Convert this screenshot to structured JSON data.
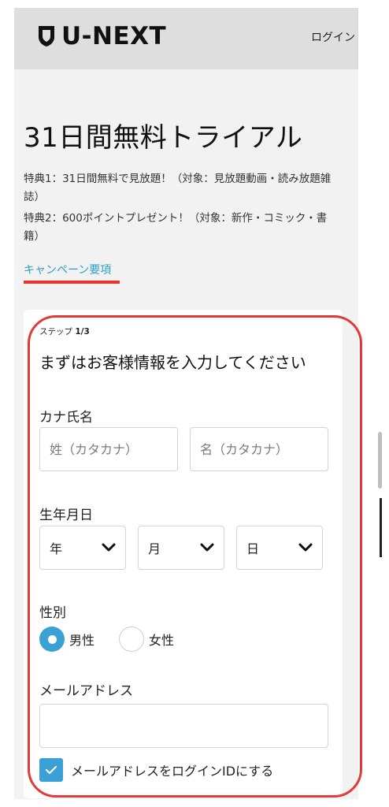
{
  "header": {
    "logo_text": "U-NEXT",
    "login_label": "ログイン"
  },
  "main": {
    "title": "31日間無料トライアル",
    "benefit1": "特典1：31日間無料で見放題！（対象：見放題動画・読み放題雑誌）",
    "benefit2": "特典2：600ポイントプレゼント！（対象：新作・コミック・書籍）",
    "campaign_link": "キャンペーン要項"
  },
  "form": {
    "step_label": "ステップ",
    "step_value": "1/3",
    "heading": "まずはお客様情報を入力してください",
    "kana_label": "カナ氏名",
    "sei_placeholder": "姓（カタカナ）",
    "mei_placeholder": "名（カタカナ）",
    "birth_label": "生年月日",
    "year_label": "年",
    "month_label": "月",
    "day_label": "日",
    "gender_label": "性別",
    "male_label": "男性",
    "female_label": "女性",
    "selected_gender": "男性",
    "email_label": "メールアドレス",
    "email_value": "",
    "login_id_checkbox_label": "メールアドレスをログインIDにする",
    "login_id_checked": true
  },
  "colors": {
    "accent": "#3aa0d6",
    "link": "#2d9fc4",
    "highlight": "#e23a36"
  }
}
